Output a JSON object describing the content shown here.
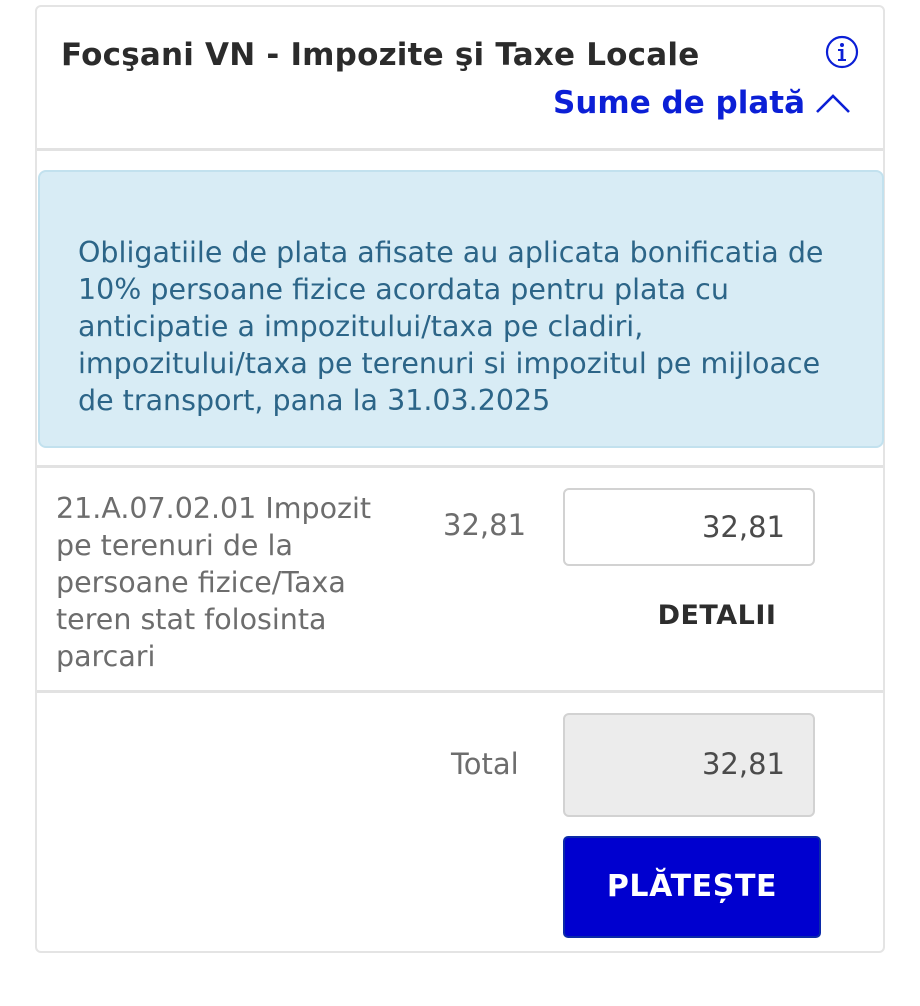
{
  "header": {
    "title": "Focşani VN - Impozite şi Taxe Locale",
    "toggle_label": "Sume de plată",
    "info_icon": "info-circle-icon",
    "toggle_icon": "chevron-up-icon"
  },
  "alert": {
    "text": "Obligatiile de plata afisate au aplicata bonificatia de 10% persoane fizice acordata pentru plata cu anticipatie a impozitului/taxa pe cladiri, impozitului/taxa pe terenuri si impozitul pe mijloace de transport, pana la 31.03.2025"
  },
  "items": [
    {
      "description": "21.A.07.02.01 Impozit pe terenuri de la persoane fizice/Taxa teren stat folosinta parcari",
      "amount": "32,81",
      "input_value": "32,81",
      "details_label": "DETALII"
    }
  ],
  "footer": {
    "total_label": "Total",
    "total_value": "32,81",
    "pay_label": "PLĂTEȘTE"
  },
  "colors": {
    "accent": "#0b1fd6",
    "pay_button": "#0000cf",
    "alert_bg": "#d8ecf5",
    "alert_text": "#2c6588"
  }
}
